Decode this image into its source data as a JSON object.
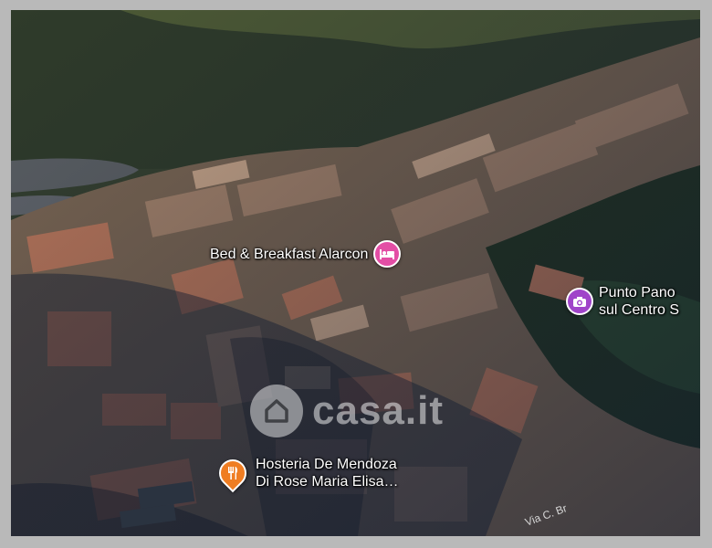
{
  "map": {
    "pois": [
      {
        "name": "Bed & Breakfast Alarcon",
        "category": "lodging",
        "icon": "bed-icon",
        "color": "#e34ea5"
      },
      {
        "name": "Punto Pano",
        "name_line2": "sul Centro S",
        "category": "viewpoint",
        "icon": "camera-icon",
        "color": "#a044c9"
      },
      {
        "name": "Hosteria De Mendoza",
        "name_line2": "Di Rose Maria Elisa…",
        "category": "restaurant",
        "icon": "fork-knife-icon",
        "color": "#ef7d22"
      }
    ],
    "street_label": "Via C. Br",
    "watermark": {
      "text": "casa.it",
      "icon": "house-icon"
    }
  }
}
